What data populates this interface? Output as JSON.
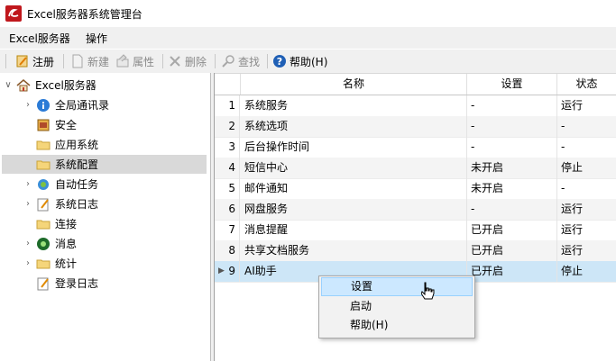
{
  "window": {
    "title": "Excel服务器系统管理台"
  },
  "menu": {
    "items": [
      "Excel服务器",
      "操作"
    ]
  },
  "toolbar": {
    "register": "注册",
    "new": "新建",
    "properties": "属性",
    "delete": "删除",
    "find": "查找",
    "help": "帮助(H)"
  },
  "tree": {
    "root": "Excel服务器",
    "items": [
      {
        "label": "全局通讯录",
        "icon": "info-icon",
        "expandable": true
      },
      {
        "label": "安全",
        "icon": "security-icon",
        "expandable": false
      },
      {
        "label": "应用系统",
        "icon": "folder-icon",
        "expandable": false
      },
      {
        "label": "系统配置",
        "icon": "folder-icon",
        "expandable": false,
        "selected": true
      },
      {
        "label": "自动任务",
        "icon": "task-icon",
        "expandable": true
      },
      {
        "label": "系统日志",
        "icon": "log-icon",
        "expandable": true
      },
      {
        "label": "连接",
        "icon": "folder-icon",
        "expandable": false
      },
      {
        "label": "消息",
        "icon": "message-icon",
        "expandable": true
      },
      {
        "label": "统计",
        "icon": "folder-icon",
        "expandable": true
      },
      {
        "label": "登录日志",
        "icon": "log-icon",
        "expandable": false
      }
    ]
  },
  "grid": {
    "columns": [
      "名称",
      "设置",
      "状态"
    ],
    "rows": [
      {
        "num": "1",
        "name": "系统服务",
        "setting": "-",
        "status": "运行"
      },
      {
        "num": "2",
        "name": "系统选项",
        "setting": "-",
        "status": "-"
      },
      {
        "num": "3",
        "name": "后台操作时间",
        "setting": "-",
        "status": "-"
      },
      {
        "num": "4",
        "name": "短信中心",
        "setting": "未开启",
        "status": "停止"
      },
      {
        "num": "5",
        "name": "邮件通知",
        "setting": "未开启",
        "status": "-"
      },
      {
        "num": "6",
        "name": "网盘服务",
        "setting": "-",
        "status": "运行"
      },
      {
        "num": "7",
        "name": "消息提醒",
        "setting": "已开启",
        "status": "运行"
      },
      {
        "num": "8",
        "name": "共享文档服务",
        "setting": "已开启",
        "status": "运行"
      },
      {
        "num": "9",
        "name": "AI助手",
        "setting": "已开启",
        "status": "停止"
      }
    ]
  },
  "context_menu": {
    "items": [
      "设置",
      "启动",
      "帮助(H)"
    ]
  },
  "colors": {
    "selected_row": "#cde6f7",
    "menu_hover": "#cce8ff",
    "tree_selected": "#d9d9d9",
    "logo_red": "#c0171c"
  }
}
